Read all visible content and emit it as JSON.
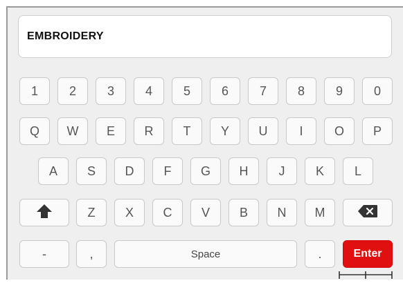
{
  "input": {
    "value": "EMBROIDERY"
  },
  "keyboard": {
    "row1": [
      "1",
      "2",
      "3",
      "4",
      "5",
      "6",
      "7",
      "8",
      "9",
      "0"
    ],
    "row2": [
      "Q",
      "W",
      "E",
      "R",
      "T",
      "Y",
      "U",
      "I",
      "O",
      "P"
    ],
    "row3": [
      "A",
      "S",
      "D",
      "F",
      "G",
      "H",
      "J",
      "K",
      "L"
    ],
    "row4": [
      "Z",
      "X",
      "C",
      "V",
      "B",
      "N",
      "M"
    ],
    "row5": {
      "dash": "-",
      "comma": ",",
      "space": "Space",
      "period": ".",
      "enter": "Enter"
    },
    "icons": {
      "shift": "shift-icon",
      "backspace": "backspace-icon"
    },
    "colors": {
      "enter": "#e01010",
      "background": "#efeff0"
    }
  }
}
